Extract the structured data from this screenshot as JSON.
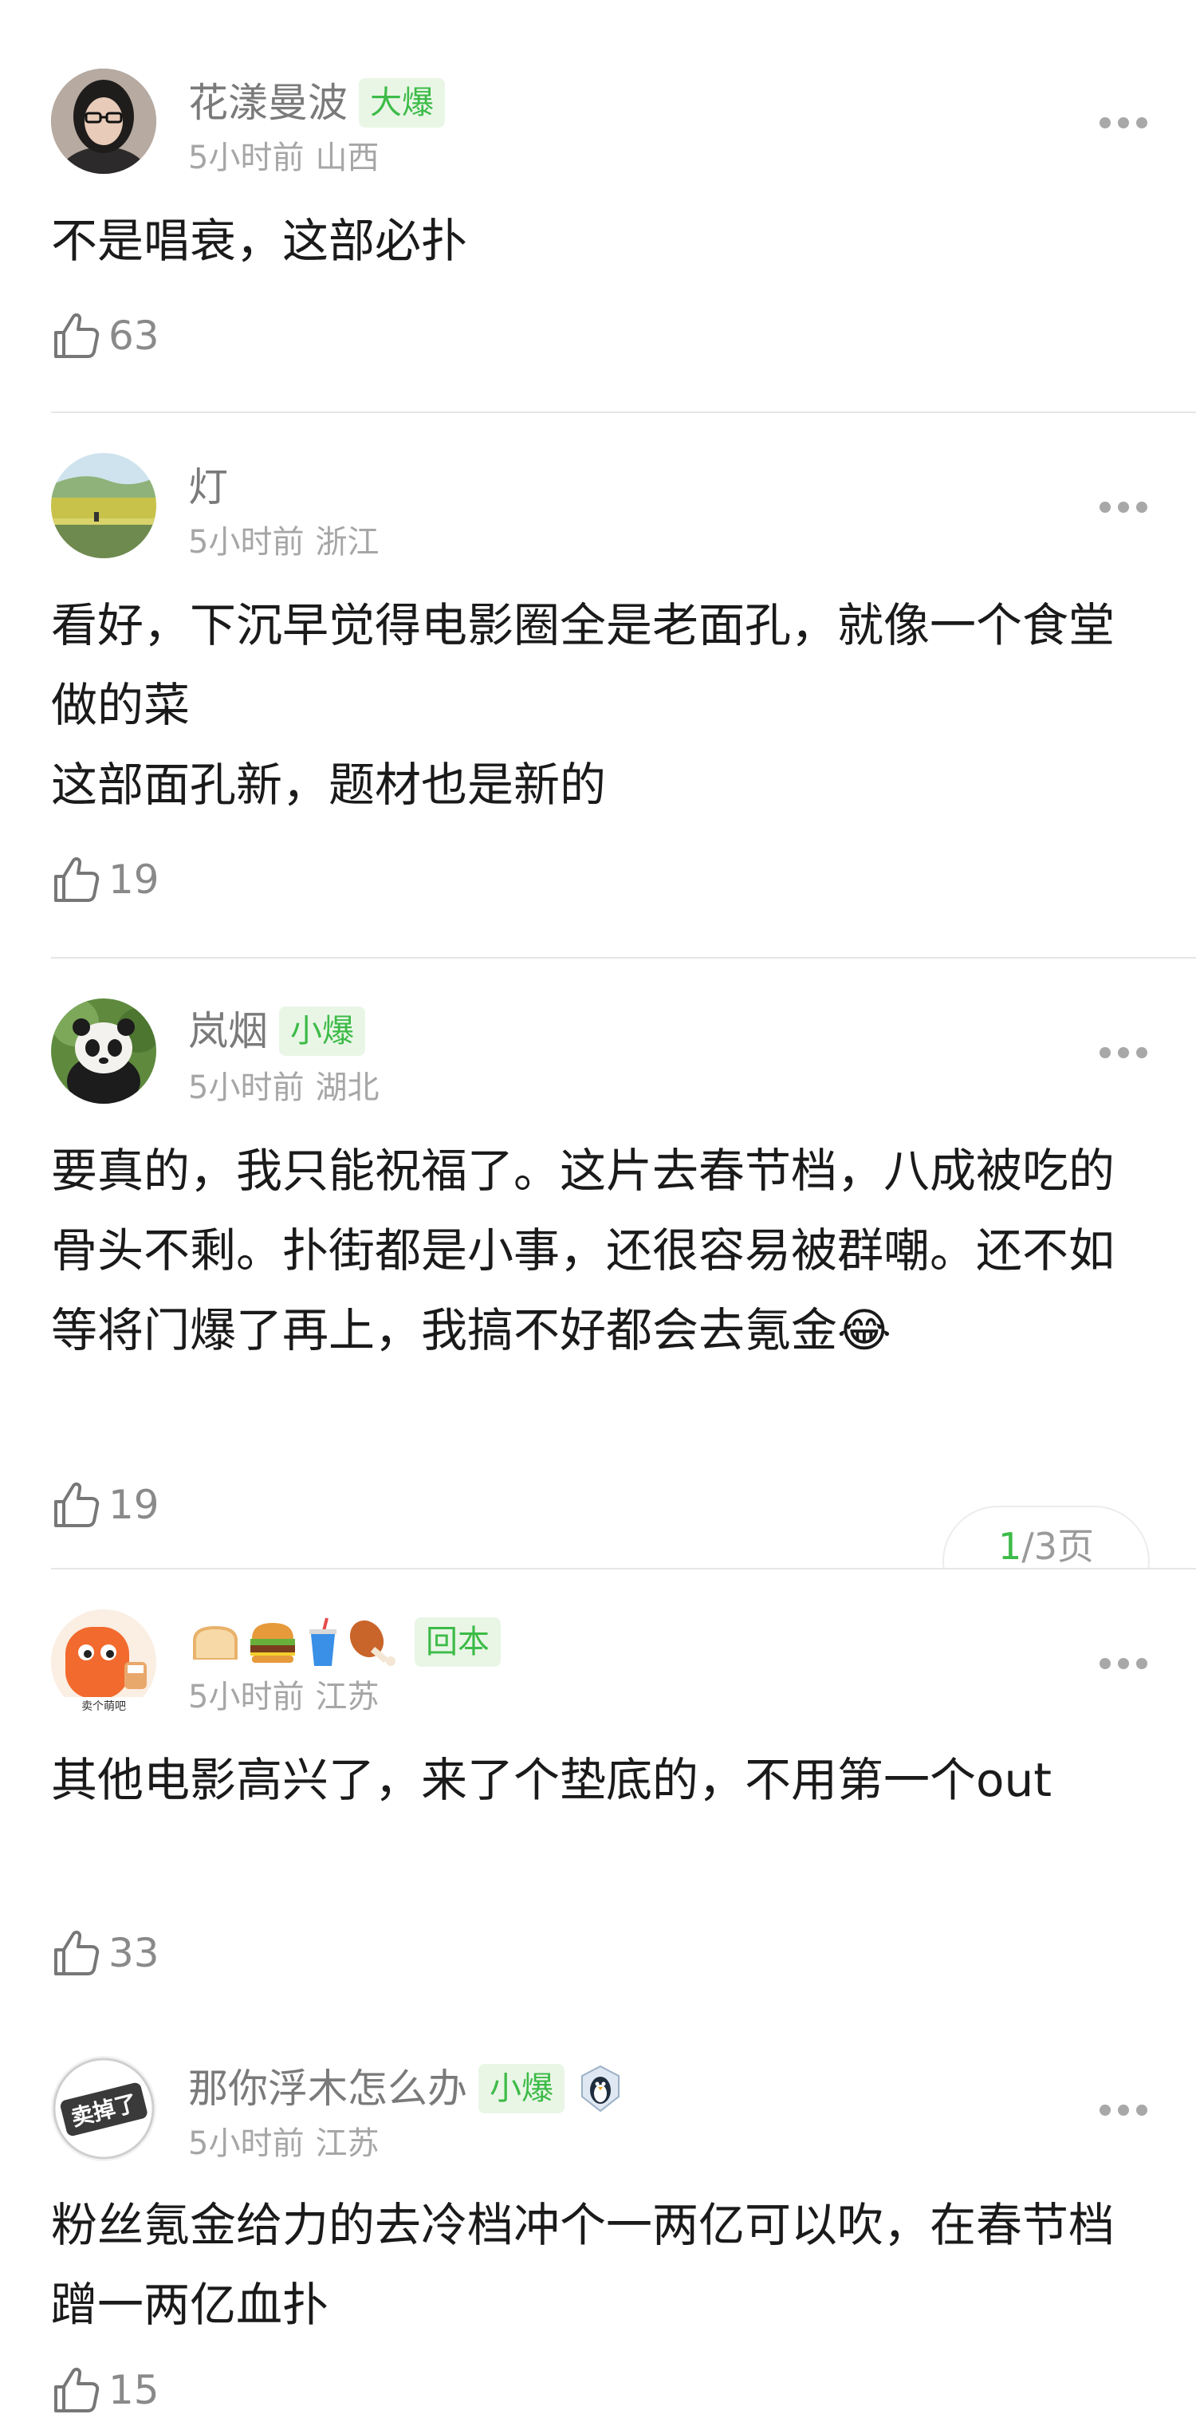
{
  "comments": [
    {
      "username": "花漾曼波",
      "badge": "大爆",
      "time": "5小时前",
      "location": "山西",
      "text": "不是唱衰，这部必扑",
      "likes": "63"
    },
    {
      "username": "灯",
      "badge": "",
      "time": "5小时前",
      "location": "浙江",
      "text": "看好，下沉早觉得电影圈全是老面孔，就像一个食堂做的菜\n这部面孔新，题材也是新的",
      "likes": "19"
    },
    {
      "username": "岚烟",
      "badge": "小爆",
      "time": "5小时前",
      "location": "湖北",
      "text": "要真的，我只能祝福了。这片去春节档，八成被吃的骨头不剩。扑街都是小事，还很容易被群嘲。还不如等将门爆了再上，我搞不好都会去氪金😂",
      "likes": "19"
    },
    {
      "username": "🍞🍔🥤🍗",
      "badge": "回本",
      "time": "5小时前",
      "location": "江苏",
      "text": "其他电影高兴了，来了个垫底的，不用第一个out",
      "likes": "33",
      "avatar_caption": "卖个萌吧"
    },
    {
      "username": "那你浮木怎么办",
      "badge": "小爆",
      "time": "5小时前",
      "location": "江苏",
      "text": "粉丝氪金给力的去冷档冲个一两亿可以吹，在春节档蹭一两亿血扑",
      "likes": "15",
      "avatar_caption": "卖掉了"
    }
  ],
  "pager": {
    "current": "1",
    "rest": "/3页"
  },
  "colors": {
    "badge_green": "#3dbb48",
    "badge_bg": "#e9f6e6",
    "username_gray": "#7a7a7a",
    "meta_gray": "#a6a6a6"
  },
  "icons": [
    "thumbs-up-icon",
    "more-dots-icon",
    "bread-icon",
    "burger-icon",
    "drink-icon",
    "drumstick-icon",
    "penguin-icon"
  ]
}
